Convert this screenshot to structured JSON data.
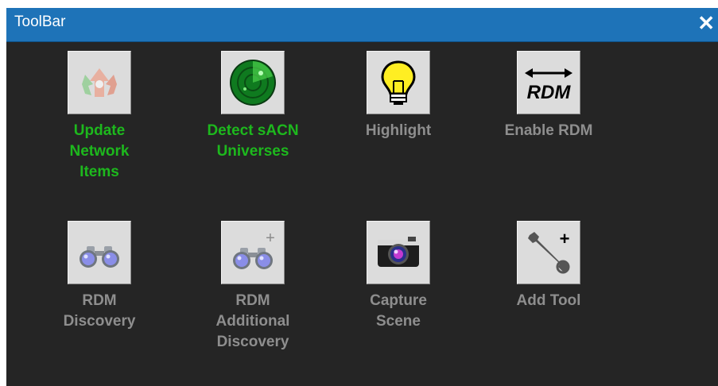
{
  "window": {
    "title": "ToolBar",
    "close_glyph": "✕"
  },
  "colors": {
    "titlebar": "#1e73b8",
    "background": "#252525",
    "active_label": "#1db81d",
    "inactive_label": "#8e8e8e"
  },
  "tools": [
    {
      "label": "Update\nNetwork\nItems",
      "icon": "network-update-icon",
      "state": "active"
    },
    {
      "label": "Detect sACN\nUniverses",
      "icon": "radar-icon",
      "state": "active"
    },
    {
      "label": "Highlight",
      "icon": "lightbulb-icon",
      "state": "inactive"
    },
    {
      "label": "Enable RDM",
      "icon": "rdm-arrows-icon",
      "icon_text": "RDM",
      "state": "inactive"
    },
    {
      "label": "RDM\nDiscovery",
      "icon": "binoculars-icon",
      "state": "inactive"
    },
    {
      "label": "RDM\nAdditional\nDiscovery",
      "icon": "binoculars-plus-icon",
      "icon_text": "+",
      "state": "inactive"
    },
    {
      "label": "Capture\nScene",
      "icon": "camera-icon",
      "state": "inactive"
    },
    {
      "label": "Add Tool",
      "icon": "wrench-plus-icon",
      "icon_text": "+",
      "state": "inactive"
    }
  ]
}
